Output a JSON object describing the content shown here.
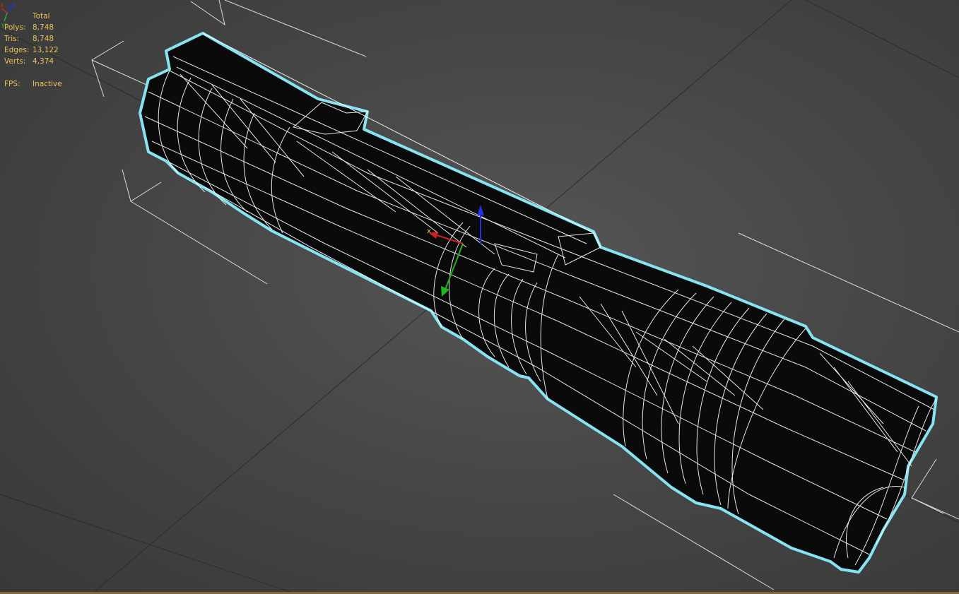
{
  "stats": {
    "header": "Total",
    "rows": [
      {
        "label": "Polys:",
        "value": "8,748"
      },
      {
        "label": "Tris:",
        "value": "8,748"
      },
      {
        "label": "Edges:",
        "value": "13,122"
      },
      {
        "label": "Verts:",
        "value": "4,374"
      }
    ],
    "fps_label": "FPS:",
    "fps_value": "Inactive"
  },
  "gizmo": {
    "x_label": "x",
    "y_label": "y",
    "z_label": "z"
  },
  "viewcube_axes": {
    "x": "x",
    "y": "y",
    "z": "z"
  },
  "colors": {
    "background": "#484848",
    "selection_outline": "#86e4f2",
    "wireframe": "#ffffff",
    "stats_text": "#e8c25a",
    "axis_x": "#d22020",
    "axis_y": "#22b422",
    "axis_z": "#2230e0"
  }
}
